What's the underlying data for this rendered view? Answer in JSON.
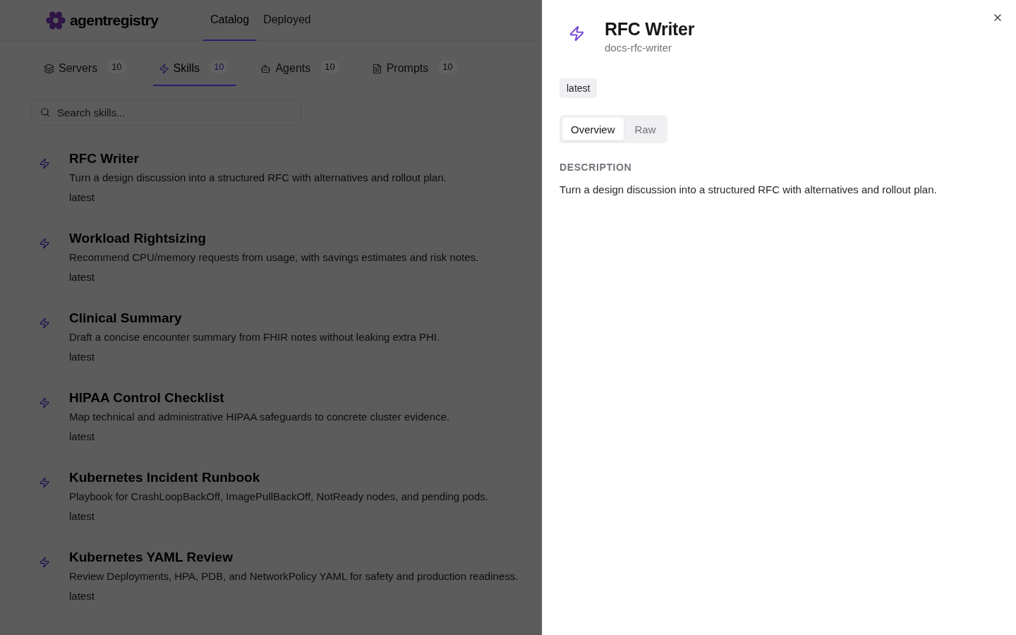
{
  "header": {
    "logo_text": "agentregistry",
    "nav": [
      {
        "label": "Catalog",
        "selected": true
      },
      {
        "label": "Deployed",
        "selected": false
      }
    ]
  },
  "category_tabs": [
    {
      "kind": "servers",
      "label": "Servers",
      "count": "10",
      "selected": false
    },
    {
      "kind": "skills",
      "label": "Skills",
      "count": "10",
      "selected": true
    },
    {
      "kind": "agents",
      "label": "Agents",
      "count": "10",
      "selected": false
    },
    {
      "kind": "prompts",
      "label": "Prompts",
      "count": "10",
      "selected": false
    }
  ],
  "search": {
    "placeholder": "Search skills..."
  },
  "skills": [
    {
      "title": "RFC Writer",
      "description": "Turn a design discussion into a structured RFC with alternatives and rollout plan.",
      "version": "latest"
    },
    {
      "title": "Workload Rightsizing",
      "description": "Recommend CPU/memory requests from usage, with savings estimates and risk notes.",
      "version": "latest"
    },
    {
      "title": "Clinical Summary",
      "description": "Draft a concise encounter summary from FHIR notes without leaking extra PHI.",
      "version": "latest"
    },
    {
      "title": "HIPAA Control Checklist",
      "description": "Map technical and administrative HIPAA safeguards to concrete cluster evidence.",
      "version": "latest"
    },
    {
      "title": "Kubernetes Incident Runbook",
      "description": "Playbook for CrashLoopBackOff, ImagePullBackOff, NotReady nodes, and pending pods.",
      "version": "latest"
    },
    {
      "title": "Kubernetes YAML Review",
      "description": "Review Deployments, HPA, PDB, and NetworkPolicy YAML for safety and production readiness.",
      "version": "latest"
    }
  ],
  "detail_panel": {
    "title": "RFC Writer",
    "slug": "docs-rfc-writer",
    "badge": "latest",
    "tabs": [
      {
        "label": "Overview",
        "selected": true
      },
      {
        "label": "Raw",
        "selected": false
      }
    ],
    "section_heading": "DESCRIPTION",
    "description": "Turn a design discussion into a structured RFC with alternatives and rollout plan."
  }
}
